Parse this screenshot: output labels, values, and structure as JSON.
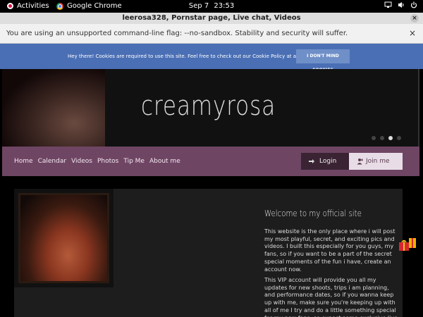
{
  "topbar": {
    "activities": "Activities",
    "app_name": "Google Chrome",
    "date": "Sep 7",
    "time": "23:53"
  },
  "window": {
    "title": "leerosa328, Pornstar page, Live chat, Videos"
  },
  "infobar": {
    "message": "You are using an unsupported command-line flag: --no-sandbox. Stability and security will suffer.",
    "close": "×"
  },
  "cookie": {
    "message": "Hey there! Cookies are required to use this site. Feel free to check out our Cookie Policy at any time.",
    "button": "I DON'T MIND COOKIES"
  },
  "hero": {
    "title": "creamyrosa"
  },
  "nav": {
    "links": [
      "Home",
      "Calendar",
      "Videos",
      "Photos",
      "Tip Me",
      "About me"
    ],
    "login": "Login",
    "join": "Join me"
  },
  "content": {
    "welcome": "Welcome to my official site",
    "para1": "This website is the only place where i will post my most playful, secret, and exciting pics and videos. I built this especially for you guys, my fans, so if you want to be a part of the secret special moments of the fun i have, create an account now.",
    "para2": "This VIP account will provide you all my updates for new shoots, trips i am planning, and performance dates, so if you wanna keep up with me, make sure you're keeping up with all of me I try and do a little something special for my new fans, so expect some exclusive live"
  }
}
